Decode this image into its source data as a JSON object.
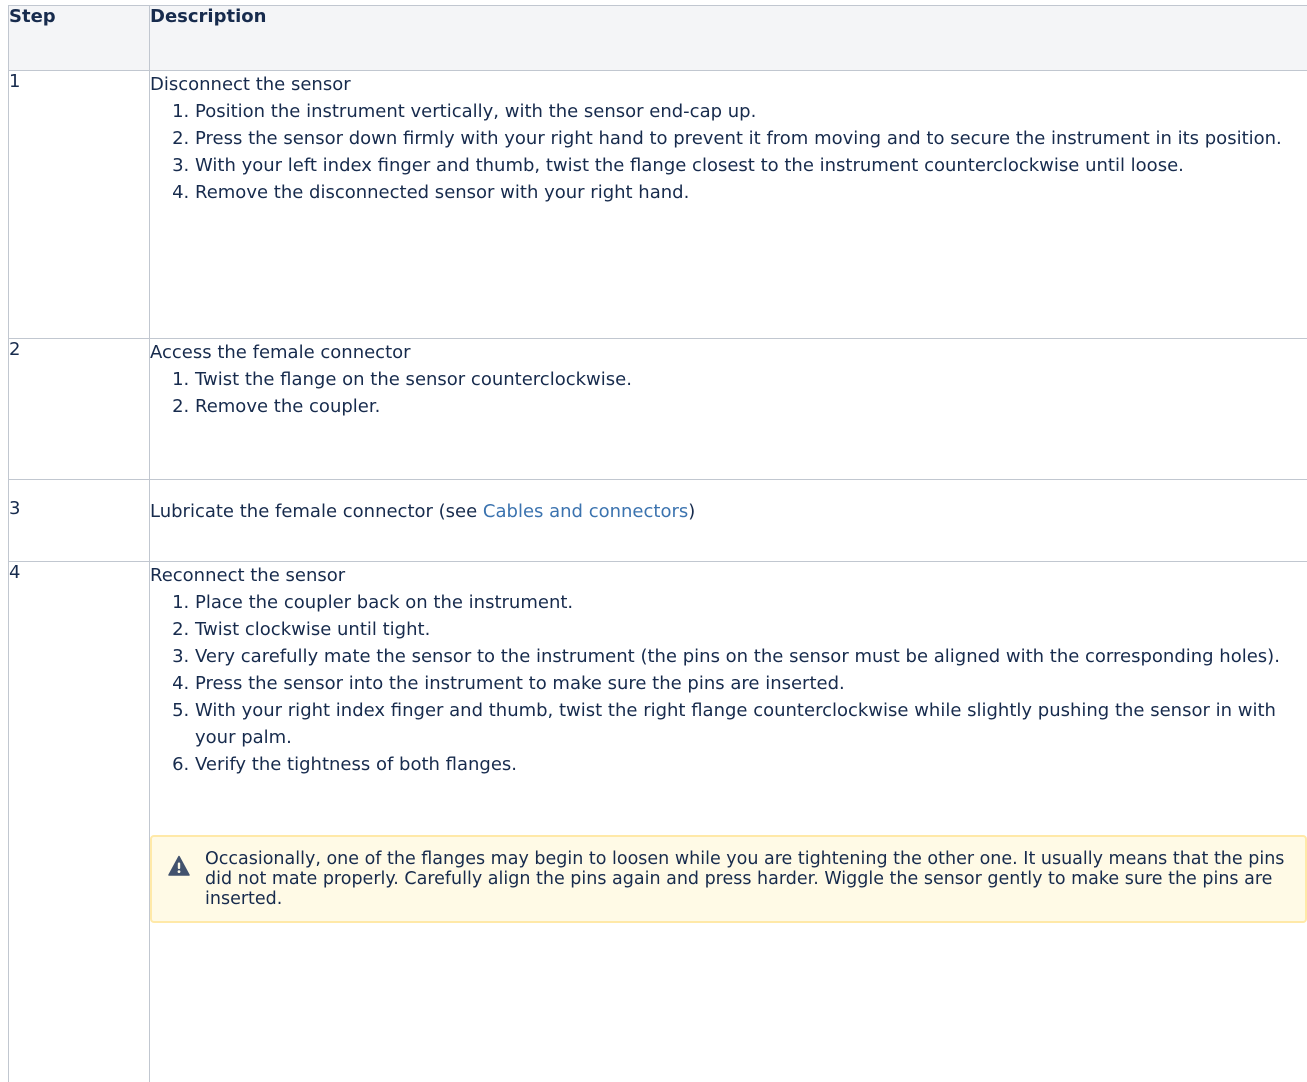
{
  "table": {
    "headers": {
      "step": "Step",
      "description": "Description"
    },
    "rows": [
      {
        "step": "1",
        "title": "Disconnect the sensor",
        "items": [
          "Position the instrument vertically, with the sensor end-cap up.",
          "Press the sensor down firmly with your right hand to prevent it from moving and to secure the instrument in its position.",
          "With your left index finger and thumb, twist the flange closest to the instrument counterclockwise until loose.",
          "Remove the disconnected sensor with your right hand."
        ]
      },
      {
        "step": "2",
        "title": "Access the female connector",
        "items": [
          "Twist the flange on the sensor counterclockwise.",
          "Remove the coupler."
        ]
      },
      {
        "step": "3",
        "title_prefix": "Lubricate the female connector (see ",
        "link_text": "Cables and connectors",
        "title_suffix": ")"
      },
      {
        "step": "4",
        "title": "Reconnect the sensor",
        "items": [
          "Place the coupler back on the instrument.",
          "Twist clockwise until tight.",
          "Very carefully mate the sensor to the instrument (the pins on the sensor must be aligned with the corresponding holes).",
          "Press the sensor into the instrument to make sure the pins are inserted.",
          "With your right index finger and thumb, twist the right flange counterclockwise while slightly pushing the sensor in with your palm.",
          "Verify the tightness of both flanges."
        ],
        "warning": "Occasionally, one of the flanges may begin to loosen while you are tightening the other one. It usually means that the pins did not mate properly. Carefully align the pins again and press harder. Wiggle the sensor gently to make sure the pins are inserted."
      }
    ]
  },
  "colors": {
    "text": "#172b4d",
    "link": "#3b73af",
    "header_bg": "#f4f5f7",
    "border": "#c1c7d0",
    "warning_bg": "#fffae6",
    "warning_border": "#ffe9a8",
    "warning_icon": "#42526e"
  },
  "icons": {
    "warning": "warning-triangle-icon"
  }
}
